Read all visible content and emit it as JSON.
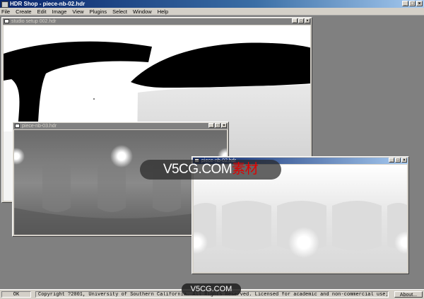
{
  "app": {
    "title": "HDR Shop - piece-nb-02.hdr",
    "controls": {
      "minimize": "_",
      "maximize": "□",
      "close": "×"
    }
  },
  "menu": [
    "File",
    "Create",
    "Edit",
    "Image",
    "View",
    "Plugins",
    "Select",
    "Window",
    "Help"
  ],
  "windows": {
    "studio": {
      "title": "studio setup 002.hdr"
    },
    "piece03": {
      "title": "piece-nb-03.hdr"
    },
    "piece02": {
      "title": "piece-nb-02.hdr"
    }
  },
  "status": {
    "ok": "OK",
    "copyright": "Copyright ?2001, University of Southern California.  All Rights Reserved. Licensed for academic and non-commercial use; for commercial",
    "about": "About..."
  },
  "watermark": {
    "main_text": "V5CG.COM",
    "main_red": "素材",
    "bottom": "V5CG.COM"
  }
}
